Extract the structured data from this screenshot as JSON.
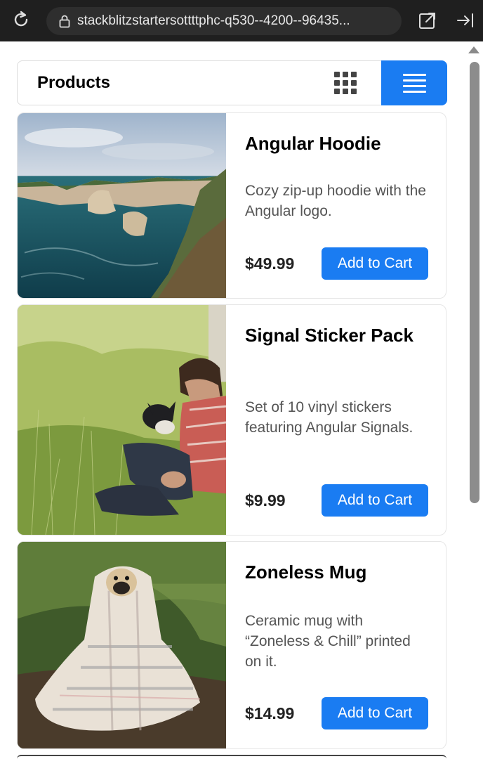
{
  "browser": {
    "url": "stackblitzstartersottttphc-q530--4200--96435...",
    "icons": [
      "reload-icon",
      "lock-icon",
      "open-external-icon",
      "collapse-sidebar-icon"
    ]
  },
  "header": {
    "title": "Products",
    "view_icons": [
      "grid-view-icon",
      "list-view-icon"
    ],
    "active_view": "list",
    "accent_color": "#1a7cf2"
  },
  "products": [
    {
      "name": "Angular Hoodie",
      "description": "Cozy zip-up hoodie with the Angular logo.",
      "price": "$49.99",
      "button": "Add to Cart",
      "image": "coastal-cliffs-photo"
    },
    {
      "name": "Signal Sticker Pack",
      "description": "Set of 10 vinyl stickers featuring Angular Signals.",
      "price": "$9.99",
      "button": "Add to Cart",
      "image": "man-with-dog-in-grass-photo"
    },
    {
      "name": "Zoneless Mug",
      "description": "Ceramic mug with “Zoneless & Chill” printed on it.",
      "price": "$14.99",
      "button": "Add to Cart",
      "image": "pug-in-blanket-photo"
    }
  ]
}
